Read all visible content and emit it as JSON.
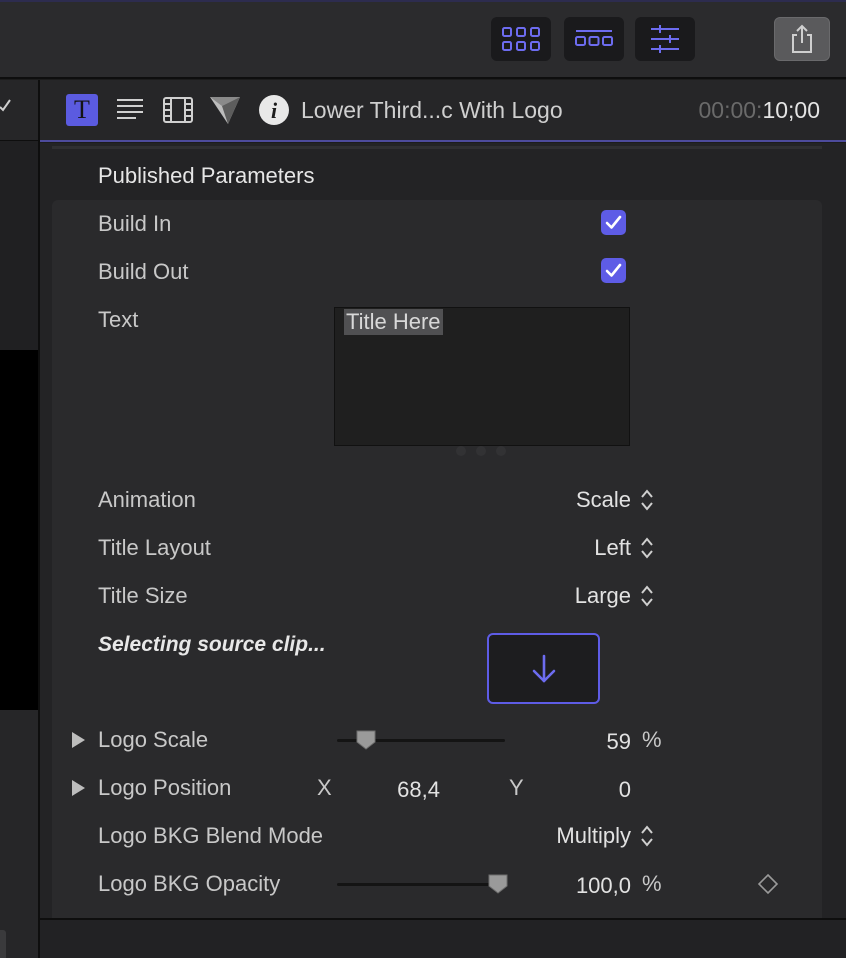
{
  "header": {
    "title": "Lower Third...c With Logo",
    "time_dim": "00:00:",
    "time_bright": "10;00"
  },
  "section": {
    "title": "Published Parameters"
  },
  "params": {
    "build_in": {
      "label": "Build In",
      "checked": true
    },
    "build_out": {
      "label": "Build Out",
      "checked": true
    },
    "text": {
      "label": "Text",
      "value": "Title Here"
    },
    "animation": {
      "label": "Animation",
      "value": "Scale"
    },
    "title_layout": {
      "label": "Title Layout",
      "value": "Left"
    },
    "title_size": {
      "label": "Title Size",
      "value": "Large"
    },
    "source": {
      "label": "Selecting source clip..."
    },
    "logo_scale": {
      "label": "Logo Scale",
      "value": "59",
      "unit": "%",
      "slider_fraction": 0.17
    },
    "logo_position": {
      "label": "Logo Position",
      "x_label": "X",
      "x_value": "68,4",
      "y_label": "Y",
      "y_value": "0"
    },
    "logo_blend": {
      "label": "Logo BKG Blend Mode",
      "value": "Multiply"
    },
    "logo_opacity": {
      "label": "Logo BKG Opacity",
      "value": "100,0",
      "unit": "%",
      "slider_fraction": 1.0
    }
  },
  "colors": {
    "accent": "#5e5ce6",
    "panel": "#2a2a2c",
    "toolbar": "#2b2b2d"
  },
  "icons": {
    "toolbar": [
      "browser-grid-icon",
      "timeline-icon",
      "inspector-sliders-icon",
      "share-icon"
    ],
    "inspector_tabs": [
      "title-tab-icon",
      "text-tab-icon",
      "video-tab-icon",
      "generator-tab-icon",
      "info-tab-icon"
    ]
  }
}
